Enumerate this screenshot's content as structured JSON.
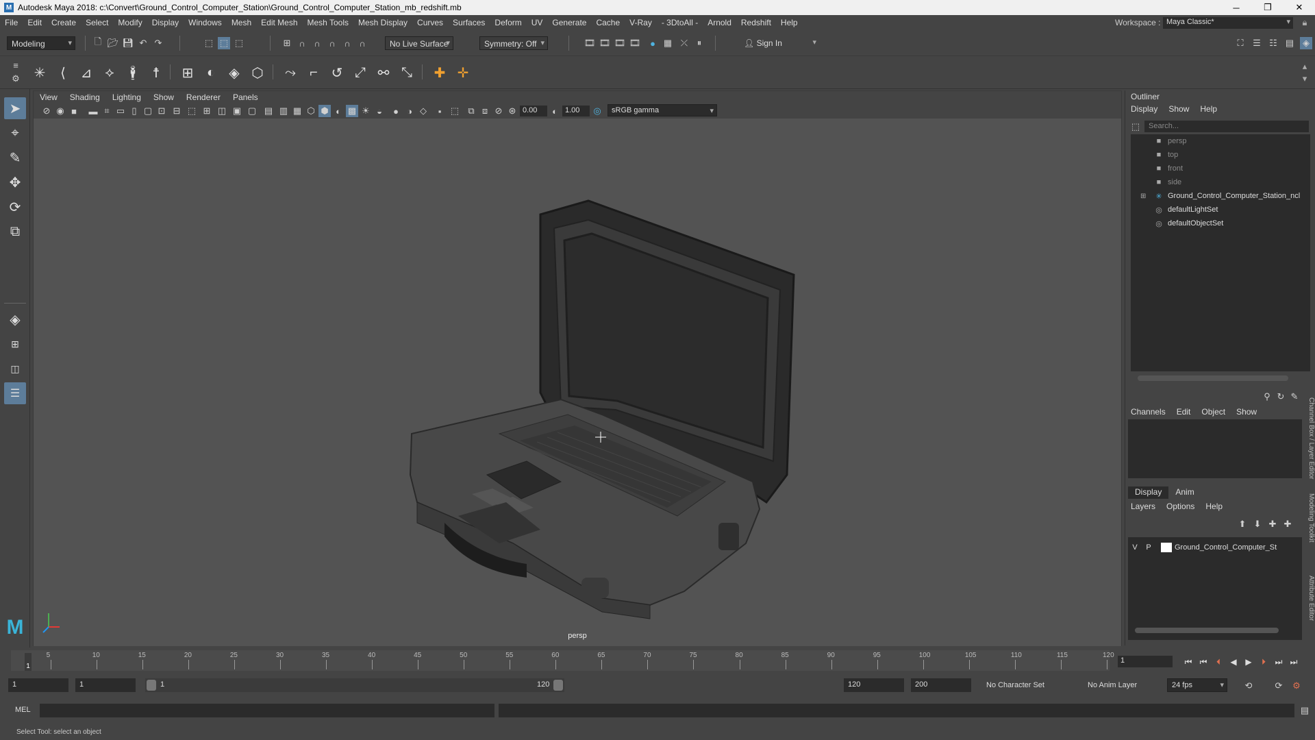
{
  "window": {
    "title": "Autodesk Maya 2018: c:\\Convert\\Ground_Control_Computer_Station\\Ground_Control_Computer_Station_mb_redshift.mb",
    "app_icon": "M",
    "minimize": "─",
    "maximize": "❐",
    "close": "✕"
  },
  "menubar": {
    "items": [
      "File",
      "Edit",
      "Create",
      "Select",
      "Modify",
      "Display",
      "Windows",
      "Mesh",
      "Edit Mesh",
      "Mesh Tools",
      "Mesh Display",
      "Curves",
      "Surfaces",
      "Deform",
      "UV",
      "Generate",
      "Cache",
      "V-Ray",
      "- 3DtoAll -",
      "Arnold",
      "Redshift",
      "Help"
    ],
    "workspace_label": "Workspace :",
    "workspace_value": "Maya Classic*"
  },
  "statusline": {
    "mode": "Modeling",
    "live_surface": "No Live Surface",
    "symmetry": "Symmetry: Off",
    "sign_in": "Sign In"
  },
  "viewport": {
    "menus": [
      "View",
      "Shading",
      "Lighting",
      "Show",
      "Renderer",
      "Panels"
    ],
    "exposure": "0.00",
    "gamma": "1.00",
    "color_space": "sRGB gamma",
    "camera_label": "persp"
  },
  "outliner": {
    "title": "Outliner",
    "menus": [
      "Display",
      "Show",
      "Help"
    ],
    "search_placeholder": "Search...",
    "items": [
      {
        "label": "persp",
        "icon": "camera-icon",
        "dim": true
      },
      {
        "label": "top",
        "icon": "camera-icon",
        "dim": true
      },
      {
        "label": "front",
        "icon": "camera-icon",
        "dim": true
      },
      {
        "label": "side",
        "icon": "camera-icon",
        "dim": true
      },
      {
        "label": "Ground_Control_Computer_Station_ncl",
        "icon": "group-icon",
        "dim": false,
        "expandable": true
      },
      {
        "label": "defaultLightSet",
        "icon": "set-icon",
        "dim": false
      },
      {
        "label": "defaultObjectSet",
        "icon": "set-icon",
        "dim": false
      }
    ]
  },
  "channelbox": {
    "menus": [
      "Channels",
      "Edit",
      "Object",
      "Show"
    ],
    "layer_tabs": [
      "Display",
      "Anim"
    ],
    "layer_menus": [
      "Layers",
      "Options",
      "Help"
    ],
    "layer": {
      "visible": "V",
      "playback": "P",
      "name": "Ground_Control_Computer_St"
    },
    "side_tabs": [
      "Channel Box / Layer Editor",
      "Modeling Toolkit",
      "Attribute Editor"
    ]
  },
  "timeslider": {
    "ticks": [
      5,
      10,
      15,
      20,
      25,
      30,
      35,
      40,
      45,
      50,
      55,
      60,
      65,
      70,
      75,
      80,
      85,
      90,
      95,
      100,
      105,
      110,
      115,
      120
    ],
    "current_frame": "1",
    "frame_field": "1"
  },
  "rangeslider": {
    "start": "1",
    "playback_start": "1",
    "range_start_label": "1",
    "range_end_label": "120",
    "playback_end": "120",
    "end": "200",
    "character_set": "No Character Set",
    "anim_layer": "No Anim Layer",
    "fps": "24 fps"
  },
  "cmdline": {
    "label": "MEL"
  },
  "helpline": {
    "text": "Select Tool: select an object"
  },
  "colors": {
    "background": "#444444",
    "viewport_bg": "#535353",
    "field_bg": "#2b2b2b",
    "active_tool": "#5d7d9a"
  }
}
